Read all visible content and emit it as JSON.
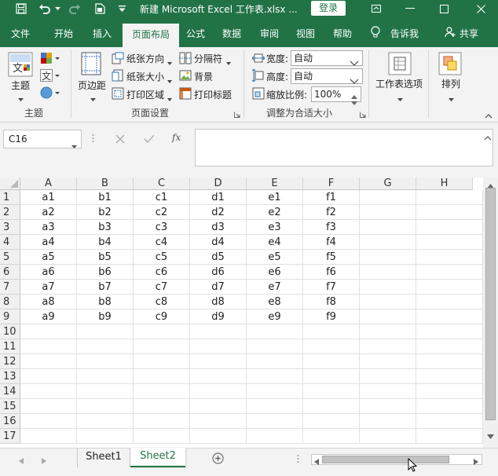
{
  "window": {
    "title": "新建 Microsoft Excel 工作表.xlsx ...",
    "login_label": "登录"
  },
  "tabs": [
    "文件",
    "开始",
    "插入",
    "页面布局",
    "公式",
    "数据",
    "审阅",
    "视图",
    "帮助",
    "告诉我",
    "共享"
  ],
  "ribbon": {
    "themes": {
      "theme_label": "主题",
      "group_label": "主题"
    },
    "page_setup": {
      "margins_label": "页边距",
      "orientation_label": "纸张方向",
      "size_label": "纸张大小",
      "print_area_label": "打印区域",
      "breaks_label": "分隔符",
      "background_label": "背景",
      "print_titles_label": "打印标题",
      "group_label": "页面设置"
    },
    "scale": {
      "width_label": "宽度:",
      "width_value": "自动",
      "height_label": "高度:",
      "height_value": "自动",
      "scale_label": "缩放比例:",
      "scale_value": "100%",
      "group_label": "调整为合适大小"
    },
    "sheet_options_label": "工作表选项",
    "arrange_label": "排列"
  },
  "formula_bar": {
    "name_box": "C16",
    "fx": "fx",
    "formula": ""
  },
  "grid": {
    "columns": [
      "A",
      "B",
      "C",
      "D",
      "E",
      "F",
      "G",
      "H"
    ],
    "rows": [
      {
        "num": "1",
        "cells": [
          "a1",
          "b1",
          "c1",
          "d1",
          "e1",
          "f1",
          "",
          ""
        ]
      },
      {
        "num": "2",
        "cells": [
          "a2",
          "b2",
          "c2",
          "d2",
          "e2",
          "f2",
          "",
          ""
        ]
      },
      {
        "num": "3",
        "cells": [
          "a3",
          "b3",
          "c3",
          "d3",
          "e3",
          "f3",
          "",
          ""
        ]
      },
      {
        "num": "4",
        "cells": [
          "a4",
          "b4",
          "c4",
          "d4",
          "e4",
          "f4",
          "",
          ""
        ]
      },
      {
        "num": "5",
        "cells": [
          "a5",
          "b5",
          "c5",
          "d5",
          "e5",
          "f5",
          "",
          ""
        ]
      },
      {
        "num": "6",
        "cells": [
          "a6",
          "b6",
          "c6",
          "d6",
          "e6",
          "f6",
          "",
          ""
        ]
      },
      {
        "num": "7",
        "cells": [
          "a7",
          "b7",
          "c7",
          "d7",
          "e7",
          "f7",
          "",
          ""
        ]
      },
      {
        "num": "8",
        "cells": [
          "a8",
          "b8",
          "c8",
          "d8",
          "e8",
          "f8",
          "",
          ""
        ]
      },
      {
        "num": "9",
        "cells": [
          "a9",
          "b9",
          "c9",
          "d9",
          "e9",
          "f9",
          "",
          ""
        ]
      },
      {
        "num": "10",
        "cells": [
          "",
          "",
          "",
          "",
          "",
          "",
          "",
          ""
        ]
      },
      {
        "num": "11",
        "cells": [
          "",
          "",
          "",
          "",
          "",
          "",
          "",
          ""
        ]
      },
      {
        "num": "12",
        "cells": [
          "",
          "",
          "",
          "",
          "",
          "",
          "",
          ""
        ]
      },
      {
        "num": "13",
        "cells": [
          "",
          "",
          "",
          "",
          "",
          "",
          "",
          ""
        ]
      },
      {
        "num": "14",
        "cells": [
          "",
          "",
          "",
          "",
          "",
          "",
          "",
          ""
        ]
      },
      {
        "num": "15",
        "cells": [
          "",
          "",
          "",
          "",
          "",
          "",
          "",
          ""
        ]
      },
      {
        "num": "16",
        "cells": [
          "",
          "",
          "",
          "",
          "",
          "",
          "",
          ""
        ]
      },
      {
        "num": "17",
        "cells": [
          "",
          "",
          "",
          "",
          "",
          "",
          "",
          ""
        ]
      }
    ]
  },
  "sheets": [
    {
      "name": "Sheet1",
      "active": false
    },
    {
      "name": "Sheet2",
      "active": true
    }
  ],
  "colors": {
    "accent": "#217346",
    "ribbon_bg": "#f3f3f3"
  }
}
